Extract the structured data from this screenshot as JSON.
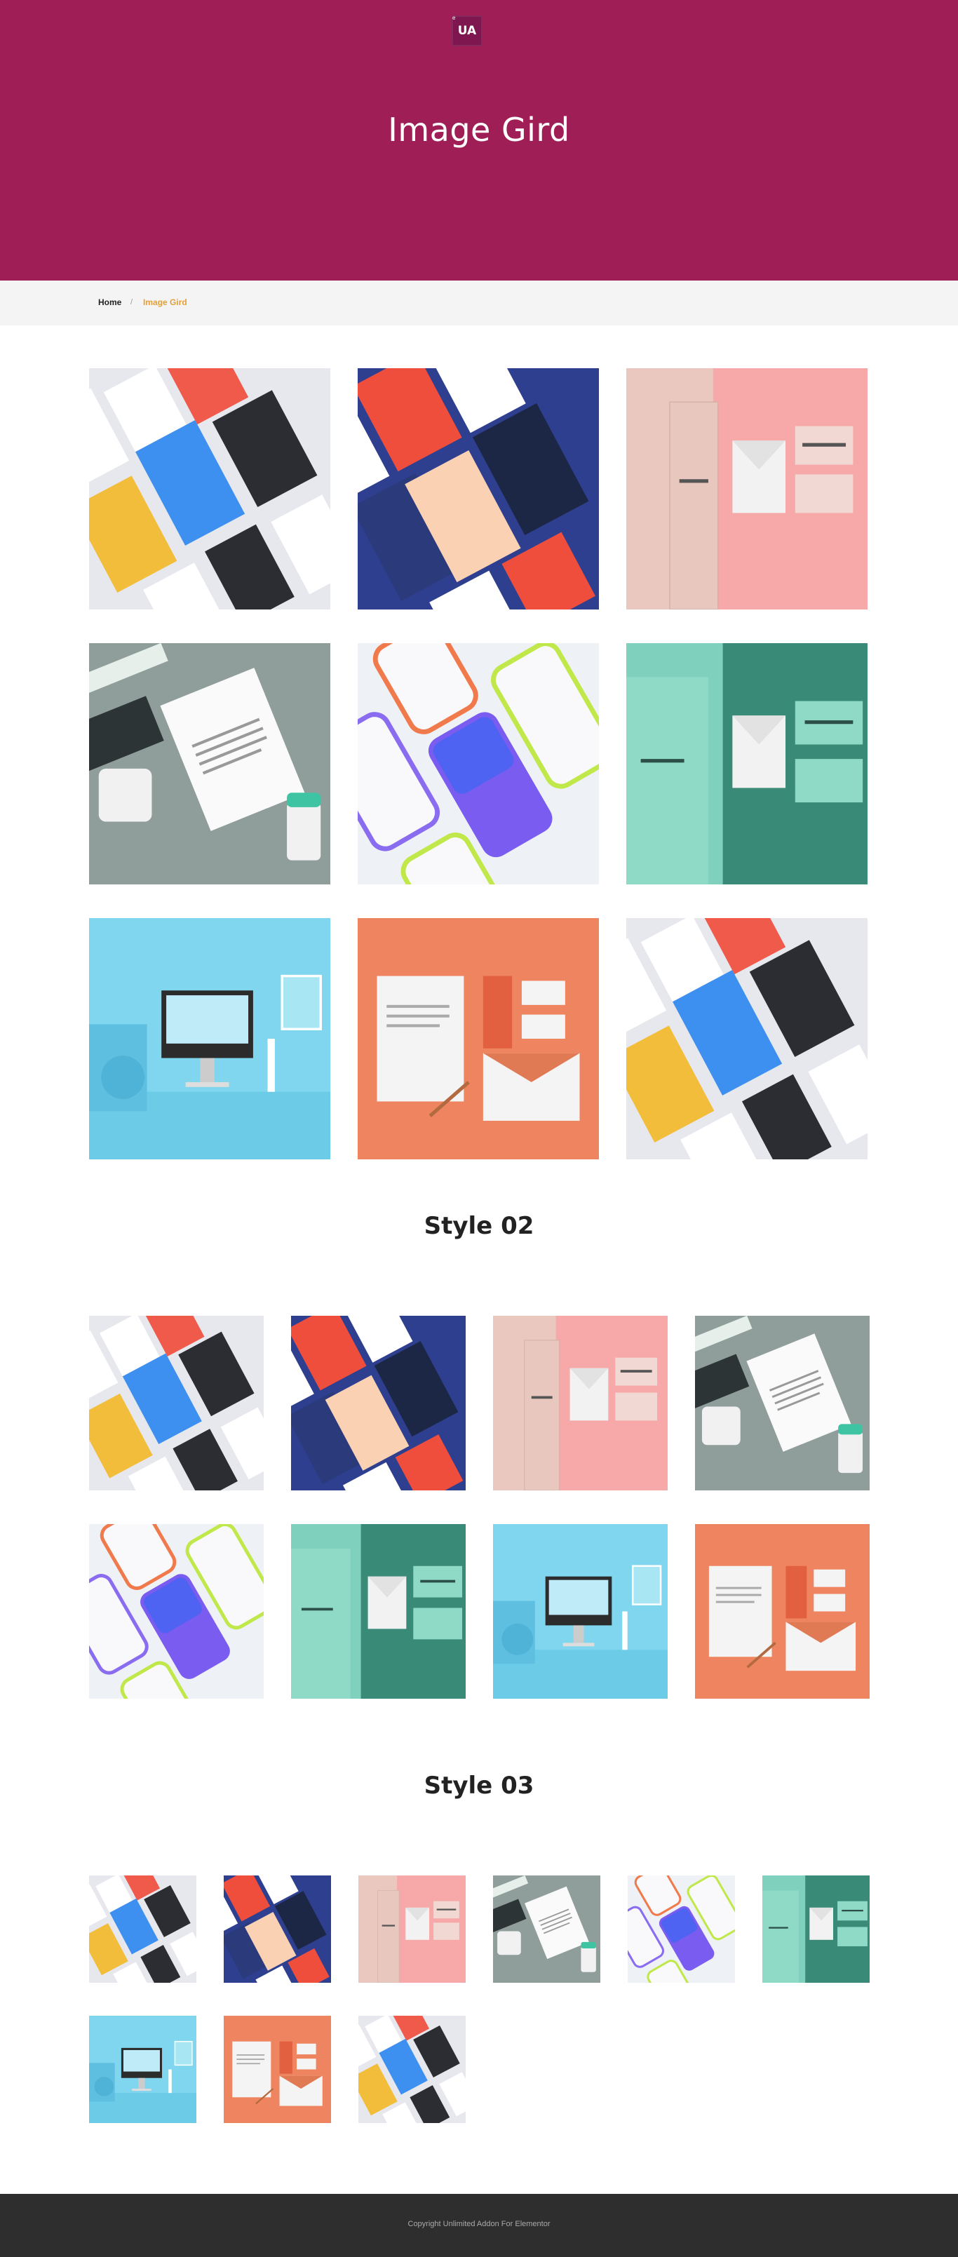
{
  "header": {
    "logo_text": "UA",
    "logo_mark": "e",
    "title": "Image Gird"
  },
  "breadcrumb": {
    "home": "Home",
    "separator": "/",
    "current": "Image Gird"
  },
  "sections": {
    "style02_title": "Style 02",
    "style03_title": "Style 03"
  },
  "gallery_images": [
    {
      "name": "mockup-color-cards-image",
      "motif": "cards"
    },
    {
      "name": "perspective-mockup-image",
      "motif": "perspective"
    },
    {
      "name": "pink-stationery-image",
      "motif": "stationery-pink"
    },
    {
      "name": "letterhead-mug-image",
      "motif": "letterhead"
    },
    {
      "name": "iphone-x-mockup-image",
      "motif": "iphone"
    },
    {
      "name": "mint-stationery-image",
      "motif": "stationery-mint"
    },
    {
      "name": "blue-desk-computer-image",
      "motif": "desk"
    },
    {
      "name": "orange-stationery-image",
      "motif": "orange"
    },
    {
      "name": "mockup-color-cards-image",
      "motif": "cards"
    }
  ],
  "colors": {
    "hero": "#a01e56",
    "accent": "#e3a03a",
    "footer": "#2e2e2e"
  },
  "footer": {
    "copyright": "Copyright Unlimited Addon For Elementor"
  }
}
